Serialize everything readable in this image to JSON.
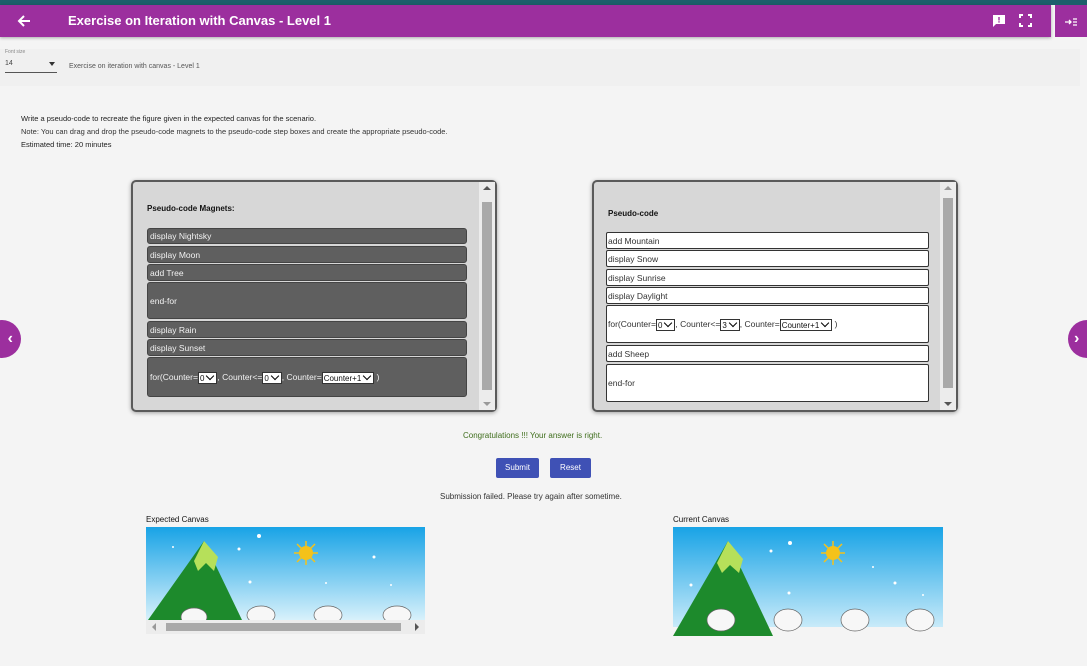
{
  "header": {
    "title": "Exercise on Iteration with Canvas - Level 1",
    "back_icon": "arrow-left",
    "chat_icon": "chat-alert",
    "fullscreen_icon": "fullscreen",
    "side_icon": "collapse-menu",
    "color": "#9c2f9e"
  },
  "font_size": {
    "label": "Font size",
    "value": "14"
  },
  "exercise_subtitle": "Exercise on iteration with canvas - Level 1",
  "instructions": {
    "line1": "Write a pseudo-code to recreate the figure given in the expected canvas for the scenario.",
    "line2": "Note: You can drag and drop the pseudo-code magnets to the pseudo-code step boxes and create the appropriate pseudo-code.",
    "line3": "Estimated time: 20 minutes"
  },
  "magnets": {
    "title": "Pseudo-code Magnets:",
    "items": [
      "display Nightsky",
      "display Moon",
      "add Tree",
      "end-for",
      "display Rain",
      "display Sunset"
    ],
    "loop": {
      "prefix": "for(Counter=",
      "start": "0",
      "mid": ", Counter<=",
      "end": "0",
      "inc_label": ", Counter=",
      "inc": "Counter+1",
      "suffix": ")"
    }
  },
  "pseudocode": {
    "title": "Pseudo-code",
    "steps": [
      "add Mountain",
      "display Snow",
      "display Sunrise",
      "display Daylight"
    ],
    "loop": {
      "prefix": "for(Counter=",
      "start": "0",
      "mid": ", Counter<=",
      "end": "3",
      "inc_label": ", Counter=",
      "inc": "Counter+1",
      "suffix": ")"
    },
    "after": [
      "add Sheep",
      "end-for"
    ]
  },
  "messages": {
    "success": "Congratulations !!! Your answer is right.",
    "failure": "Submission failed. Please try again after sometime."
  },
  "buttons": {
    "submit": "Submit",
    "reset": "Reset",
    "accent": "#3f51b5"
  },
  "canvases": {
    "expected_label": "Expected Canvas",
    "current_label": "Current Canvas"
  },
  "nav": {
    "prev": "‹",
    "next": "›"
  }
}
